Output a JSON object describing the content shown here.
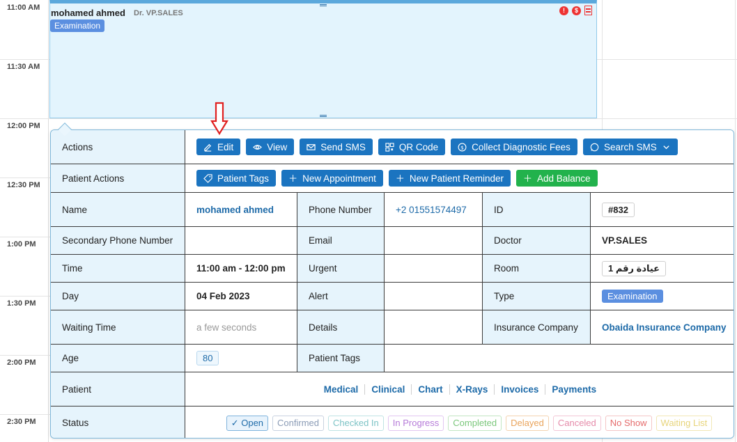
{
  "calendar": {
    "times": [
      "11:00 AM",
      "11:30 AM",
      "12:00 PM",
      "12:30 PM",
      "1:00 PM",
      "1:30 PM",
      "2:00 PM",
      "2:30 PM"
    ]
  },
  "appointment": {
    "patient_name": "mohamed ahmed",
    "doctor": "Dr. VP.SALES",
    "type": "Examination",
    "flag_alert": "!",
    "flag_money": "$"
  },
  "popover": {
    "actions_label": "Actions",
    "action_buttons": {
      "edit": "Edit",
      "view": "View",
      "send_sms": "Send SMS",
      "qr_code": "QR Code",
      "collect_fees": "Collect Diagnostic Fees",
      "search_sms": "Search SMS"
    },
    "patient_actions_label": "Patient Actions",
    "patient_action_buttons": {
      "patient_tags": "Patient Tags",
      "new_appointment": "New Appointment",
      "new_reminder": "New Patient Reminder",
      "add_balance": "Add Balance"
    },
    "fields": {
      "name_label": "Name",
      "name_value": "mohamed ahmed",
      "phone_label": "Phone Number",
      "phone_value": "+2 01551574497",
      "id_label": "ID",
      "id_value": "#832",
      "secondary_phone_label": "Secondary Phone Number",
      "email_label": "Email",
      "doctor_label": "Doctor",
      "doctor_value": "VP.SALES",
      "time_label": "Time",
      "time_value": "11:00 am - 12:00 pm",
      "urgent_label": "Urgent",
      "room_label": "Room",
      "room_value": "عيادة رقم 1",
      "day_label": "Day",
      "day_value": "04 Feb 2023",
      "alert_label": "Alert",
      "type_label": "Type",
      "type_value": "Examination",
      "waiting_label": "Waiting Time",
      "waiting_value": "a few seconds",
      "details_label": "Details",
      "insurance_label": "Insurance Company",
      "insurance_value": "Obaida Insurance Company",
      "age_label": "Age",
      "age_value": "80",
      "patient_tags_label": "Patient Tags",
      "patient_label": "Patient",
      "status_label": "Status"
    },
    "patient_links": [
      "Medical",
      "Clinical",
      "Chart",
      "X-Rays",
      "Invoices",
      "Payments"
    ],
    "statuses": [
      {
        "label": "✓ Open",
        "color": "#1d6aa8",
        "border": "#7fb3dc",
        "bg": "#e8f3fc"
      },
      {
        "label": "Confirmed",
        "color": "#8a9bb5",
        "border": "#c8d2e0",
        "bg": "#ffffff"
      },
      {
        "label": "Checked In",
        "color": "#7cc3c5",
        "border": "#bfe3e4",
        "bg": "#ffffff"
      },
      {
        "label": "In Progress",
        "color": "#b57ad8",
        "border": "#e2c7f1",
        "bg": "#ffffff"
      },
      {
        "label": "Completed",
        "color": "#7bc77b",
        "border": "#c3e6c3",
        "bg": "#ffffff"
      },
      {
        "label": "Delayed",
        "color": "#e9a35a",
        "border": "#f4d3b0",
        "bg": "#ffffff"
      },
      {
        "label": "Canceled",
        "color": "#e58aa9",
        "border": "#f3c7d6",
        "bg": "#ffffff"
      },
      {
        "label": "No Show",
        "color": "#e56b6b",
        "border": "#f4c6c6",
        "bg": "#ffffff"
      },
      {
        "label": "Waiting List",
        "color": "#e7d47a",
        "border": "#f2e7b5",
        "bg": "#ffffff"
      }
    ]
  }
}
